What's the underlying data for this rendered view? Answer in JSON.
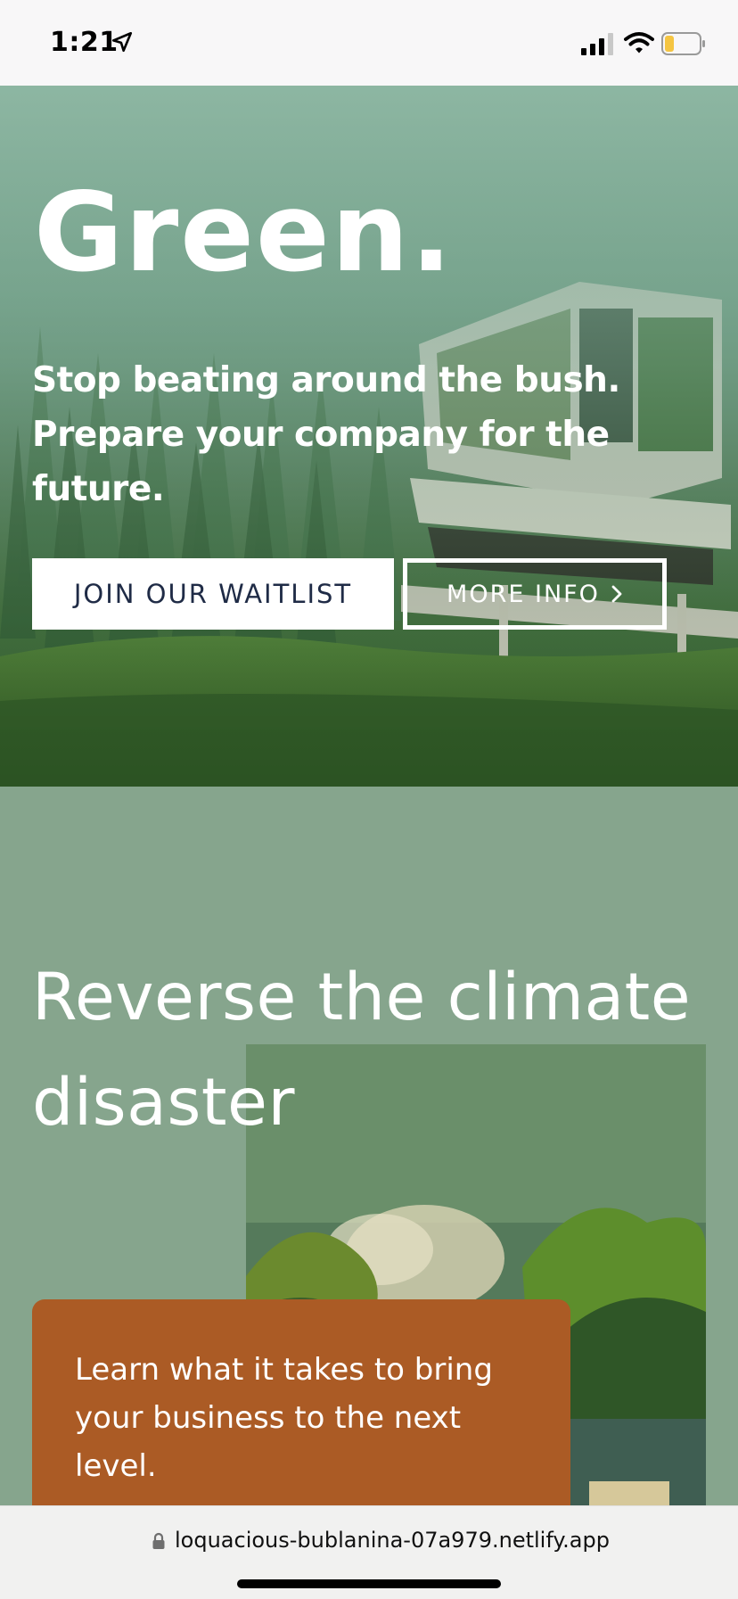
{
  "status_bar": {
    "time": "1:21",
    "icons": [
      "location-arrow-icon",
      "cellular-signal-icon",
      "wifi-icon",
      "battery-icon"
    ],
    "battery_color": "#f5c542"
  },
  "hero": {
    "title": "Green.",
    "tagline": "Stop beating around the bush. Prepare your company for the future.",
    "primary_button": "JOIN OUR WAITLIST",
    "secondary_button": "MORE INFO",
    "secondary_button_icon": "chevron-right-icon",
    "colors": {
      "primary_button_text": "#1f2b46",
      "overlay": "#6b9a82"
    }
  },
  "section": {
    "title": "Reverse the climate disaster",
    "card_text": "Learn what it takes to bring your business to the next level.",
    "colors": {
      "background": "#86a58d",
      "card": "#ab5b25"
    }
  },
  "browser": {
    "url": "loquacious-bublanina-07a979.netlify.app",
    "lock_icon": "lock-icon"
  }
}
